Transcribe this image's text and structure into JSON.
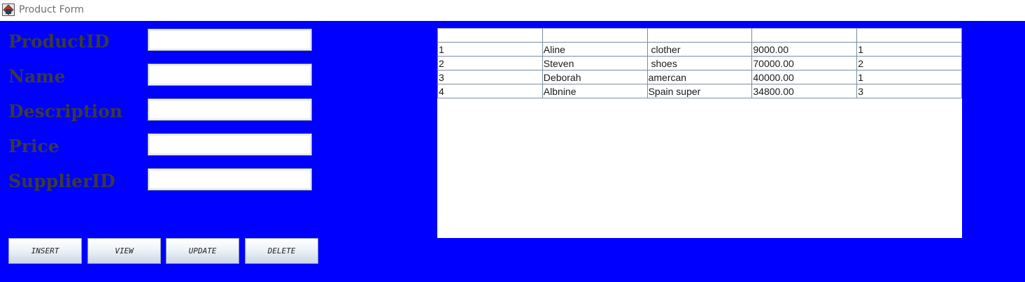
{
  "window": {
    "title": "Product Form"
  },
  "form": {
    "fields": [
      {
        "label": "ProductID",
        "value": ""
      },
      {
        "label": "Name",
        "value": ""
      },
      {
        "label": "Description",
        "value": ""
      },
      {
        "label": "Price",
        "value": ""
      },
      {
        "label": "SupplierID",
        "value": ""
      }
    ]
  },
  "buttons": {
    "insert": "INSERT",
    "view": "VIEW",
    "update": "UPDATE",
    "delete": "DELETE"
  },
  "table": {
    "headers": [
      "",
      "",
      "",
      "",
      ""
    ],
    "rows": [
      [
        "1",
        "Aline",
        " clother",
        "9000.00",
        "1"
      ],
      [
        "2",
        "Steven",
        " shoes",
        "70000.00",
        "2"
      ],
      [
        "3",
        "Deborah",
        "amercan",
        "40000.00",
        "1"
      ],
      [
        "4",
        "Albnine",
        "Spain super",
        "34800.00",
        "3"
      ]
    ]
  },
  "colors": {
    "background": "#0000ff",
    "label_text": "#3a3a3a"
  }
}
